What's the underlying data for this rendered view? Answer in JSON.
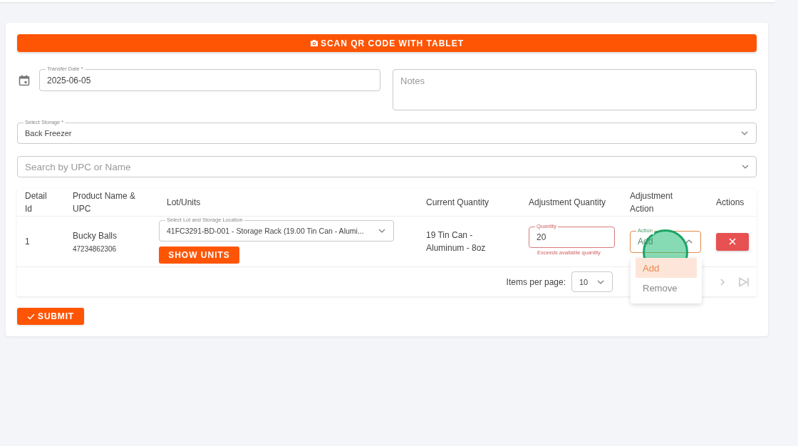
{
  "scan_button": {
    "label": "SCAN QR CODE WITH TABLET"
  },
  "transfer_date": {
    "label": "Transfer Date *",
    "value": "2025-06-05"
  },
  "notes": {
    "placeholder": "Notes"
  },
  "storage": {
    "label": "Select Storage *",
    "value": "Back Freezer"
  },
  "product_search": {
    "placeholder": "Search by UPC or Name"
  },
  "table": {
    "columns": [
      "Detail Id",
      "Product Name & UPC",
      "Lot/Units",
      "Current Quantity",
      "Adjustment Quantity",
      "Adjustment Action",
      "Actions"
    ],
    "rows": [
      {
        "detail_id": "1",
        "product_name": "Bucky Balls",
        "upc": "47234862306",
        "lot": {
          "label": "Select Lot and Storage Location",
          "value": "41FC3291-BD-001 - Storage Rack (19.00 Tin Can - Alumi..."
        },
        "show_units": "SHOW UNITS",
        "current_quantity": "19 Tin Can - Aluminum - 8oz",
        "quantity": {
          "label": "Quantity",
          "value": "20",
          "error": "Exceeds available quantity"
        },
        "action": {
          "label": "Action",
          "value": "Add",
          "expanded": true
        }
      }
    ]
  },
  "pagination": {
    "label": "Items per page:",
    "value": "10"
  },
  "action_menu": {
    "options": [
      {
        "label": "Add",
        "selected": true
      },
      {
        "label": "Remove",
        "selected": false
      }
    ]
  },
  "submit_button": {
    "label": "SUBMIT"
  }
}
